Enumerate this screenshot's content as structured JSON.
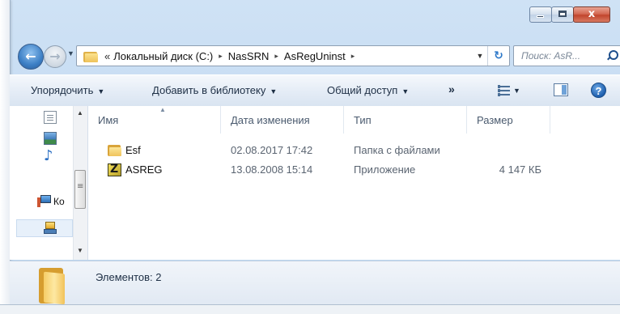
{
  "window": {
    "caption": {
      "close_glyph": "x"
    }
  },
  "nav": {
    "back_glyph": "←",
    "forward_glyph": "→",
    "address": {
      "overflow": "«",
      "segments": [
        "Локальный диск (C:)",
        "NasSRN",
        "AsRegUninst"
      ],
      "separator": "▸"
    },
    "search": {
      "placeholder": "Поиск: AsR..."
    }
  },
  "toolbar": {
    "organize": "Упорядочить",
    "add_to_library": "Добавить в библиотеку",
    "share": "Общий доступ",
    "overflow": "»",
    "help": "?"
  },
  "navpane": {
    "computer_label": "Ко"
  },
  "filelist": {
    "columns": {
      "name": "Имя",
      "date": "Дата изменения",
      "type": "Тип",
      "size": "Размер"
    },
    "rows": [
      {
        "name": "Esf",
        "date": "02.08.2017 17:42",
        "type": "Папка с файлами",
        "size": "",
        "icon": "folder-icon"
      },
      {
        "name": "ASREG",
        "date": "13.08.2008 15:14",
        "type": "Приложение",
        "size": "4 147 КБ",
        "icon": "app-icon"
      }
    ]
  },
  "details": {
    "items_count": "Элементов: 2"
  },
  "colors": {
    "frame": "#b9d3ee",
    "toolbar": "#dfe8f3",
    "close_button": "#c1452d",
    "folder": "#efc35c"
  }
}
